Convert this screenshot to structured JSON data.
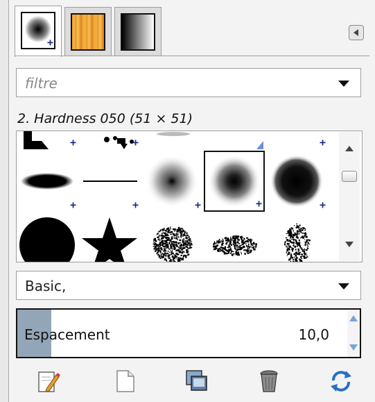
{
  "tabs": [
    {
      "name": "brushes",
      "icon": "brush-thumbnail-icon",
      "active": true
    },
    {
      "name": "patterns",
      "icon": "wood-pattern-icon",
      "active": false
    },
    {
      "name": "gradients",
      "icon": "gradient-icon",
      "active": false
    }
  ],
  "panel_menu": {
    "icon": "tab-menu-icon"
  },
  "filter": {
    "placeholder": "filtre",
    "value": ""
  },
  "selected_brush": {
    "label": "2. Hardness 050 (51 × 51)"
  },
  "brush_grid": {
    "selected_index": 8,
    "items": [
      {
        "name": "partial-block-brush"
      },
      {
        "name": "partial-splatter-brush"
      },
      {
        "name": "partial-soft-brush"
      },
      {
        "name": "partial-brush-top"
      },
      {
        "name": "partial-brush-top-right"
      },
      {
        "name": "ellipse-brush"
      },
      {
        "name": "line-brush"
      },
      {
        "name": "hardness-025-brush"
      },
      {
        "name": "hardness-050-brush"
      },
      {
        "name": "hardness-075-brush"
      },
      {
        "name": "circle-brush"
      },
      {
        "name": "star-brush"
      },
      {
        "name": "texture-brush-1"
      },
      {
        "name": "texture-brush-2"
      },
      {
        "name": "texture-brush-3"
      }
    ]
  },
  "tag_combo": {
    "value": "Basic,"
  },
  "spacing": {
    "label": "Espacement",
    "value": "10,0",
    "fraction": 0.1
  },
  "actions": [
    {
      "name": "edit-brush",
      "icon": "edit-icon"
    },
    {
      "name": "new-brush",
      "icon": "new-document-icon"
    },
    {
      "name": "duplicate-brush",
      "icon": "duplicate-icon"
    },
    {
      "name": "delete-brush",
      "icon": "trash-icon"
    },
    {
      "name": "refresh-brushes",
      "icon": "refresh-icon"
    }
  ],
  "colors": {
    "accent_blue": "#1d2d8a",
    "spin_fill": "#93a6b8",
    "arrow_blue": "#7aa4d6"
  }
}
